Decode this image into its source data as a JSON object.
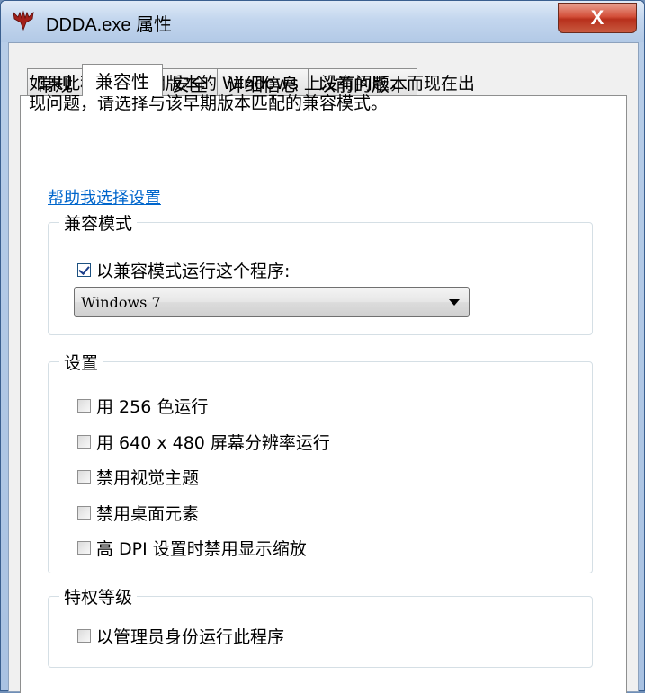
{
  "window": {
    "title": "DDDA.exe 属性",
    "close_label": "X",
    "title_icon": "app-icon"
  },
  "tabs": [
    {
      "label": "常规",
      "active": false
    },
    {
      "label": "兼容性",
      "active": true
    },
    {
      "label": "安全",
      "active": false
    },
    {
      "label": "详细信息",
      "active": false
    },
    {
      "label": "以前的版本",
      "active": false
    }
  ],
  "description": {
    "line1": "如果此程序在早期版本的 Windows 上没有问题，而现在出",
    "line2": "现问题，请选择与该早期版本匹配的兼容模式。"
  },
  "help_link": "帮助我选择设置",
  "compat_mode": {
    "title": "兼容模式",
    "checkbox_label": "以兼容模式运行这个程序:",
    "checked": true,
    "selected_os": "Windows 7"
  },
  "settings": {
    "title": "设置",
    "options": [
      {
        "label": "用 256 色运行",
        "checked": false
      },
      {
        "label": "用 640 x 480 屏幕分辨率运行",
        "checked": false
      },
      {
        "label": "禁用视觉主题",
        "checked": false
      },
      {
        "label": "禁用桌面元素",
        "checked": false
      },
      {
        "label": "高 DPI 设置时禁用显示缩放",
        "checked": false
      }
    ]
  },
  "privilege": {
    "title": "特权等级",
    "checkbox_label": "以管理员身份运行此程序",
    "checked": false
  }
}
